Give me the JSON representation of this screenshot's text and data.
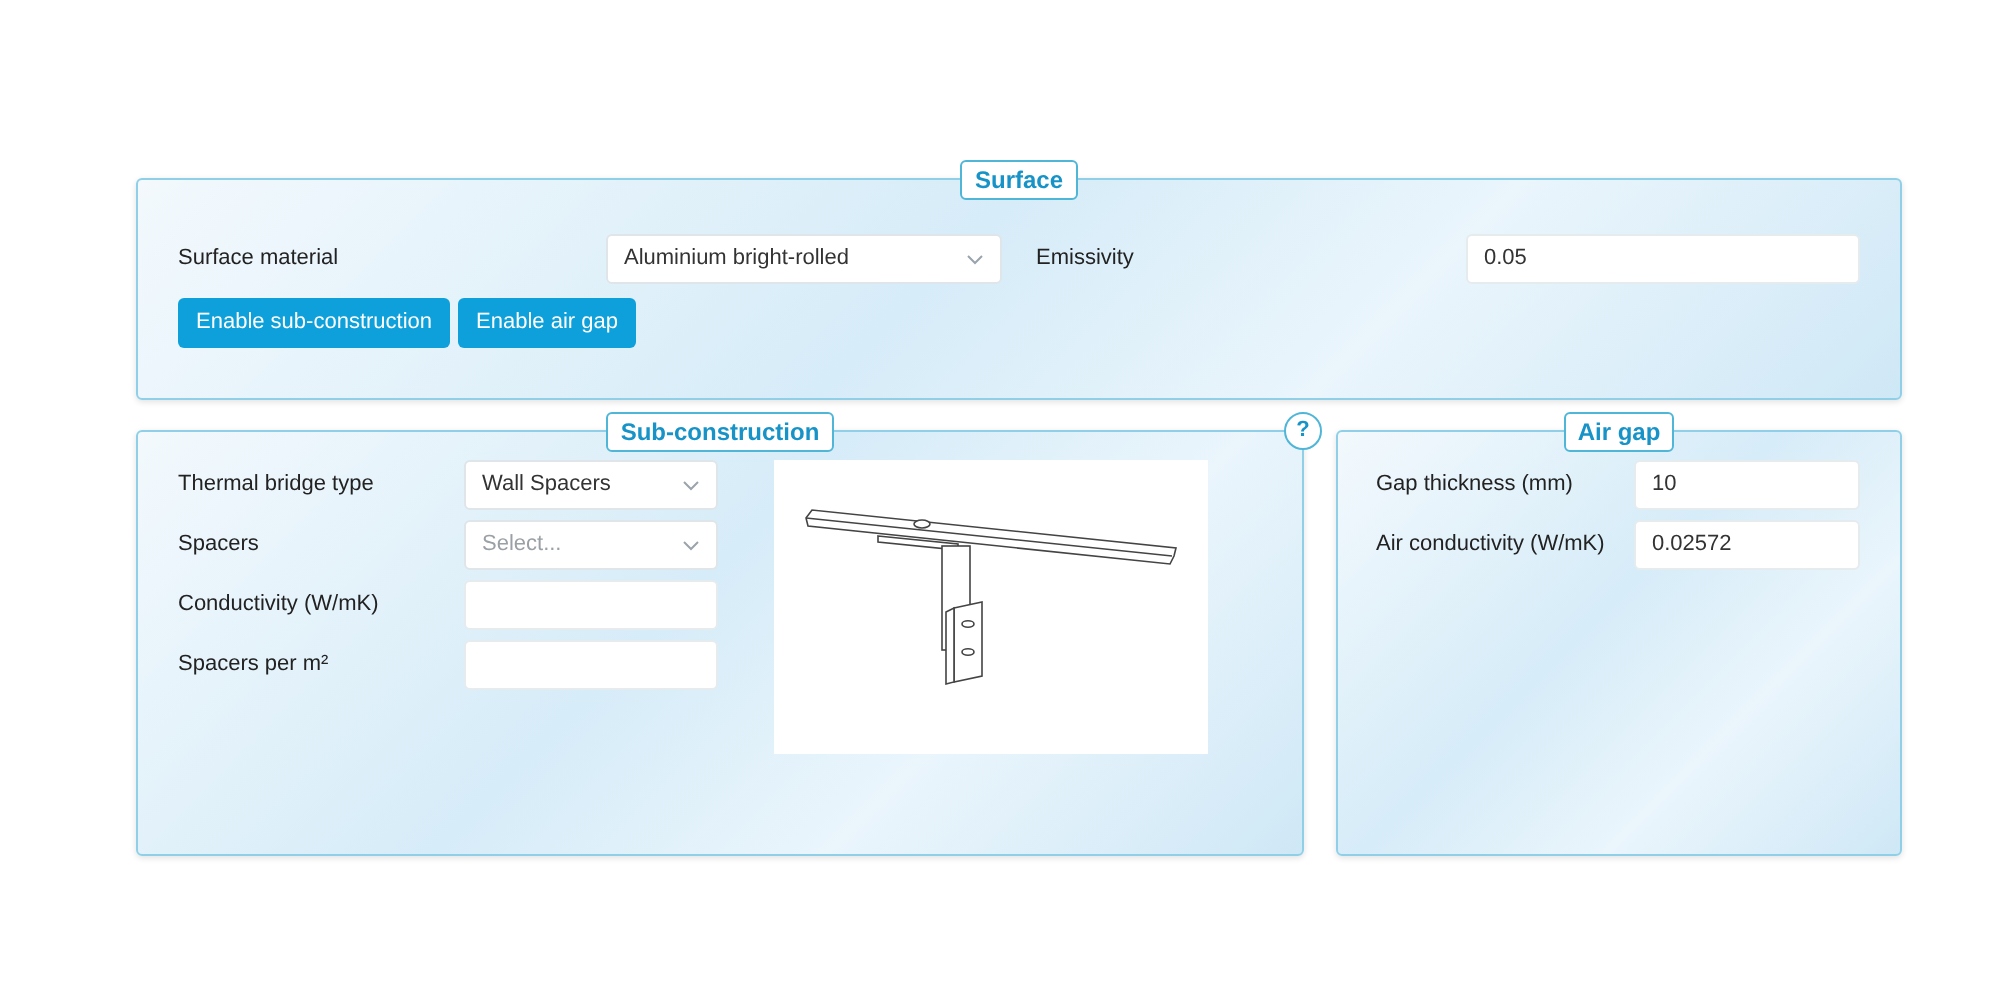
{
  "surface": {
    "title": "Surface",
    "material_label": "Surface material",
    "material": "Aluminium bright-rolled",
    "emissivity_label": "Emissivity",
    "emissivity": "0.05",
    "buttons": [
      "Enable sub-construction",
      "Enable air gap"
    ]
  },
  "sub_construction": {
    "title": "Sub-construction",
    "help": "?",
    "fields": [
      {
        "label": "Thermal bridge type",
        "kind": "select",
        "value": "Wall Spacers"
      },
      {
        "label": "Spacers",
        "kind": "select",
        "placeholder": "Select..."
      },
      {
        "label": "Conductivity (W/mK)",
        "kind": "input"
      },
      {
        "label": "Spacers per m²",
        "kind": "input"
      }
    ]
  },
  "air_gap": {
    "title": "Air gap",
    "fields": [
      {
        "label": "Gap thickness (mm)",
        "kind": "input",
        "value": "10"
      },
      {
        "label": "Air conductivity (W/mK)",
        "kind": "input",
        "value": "0.02572"
      }
    ]
  }
}
